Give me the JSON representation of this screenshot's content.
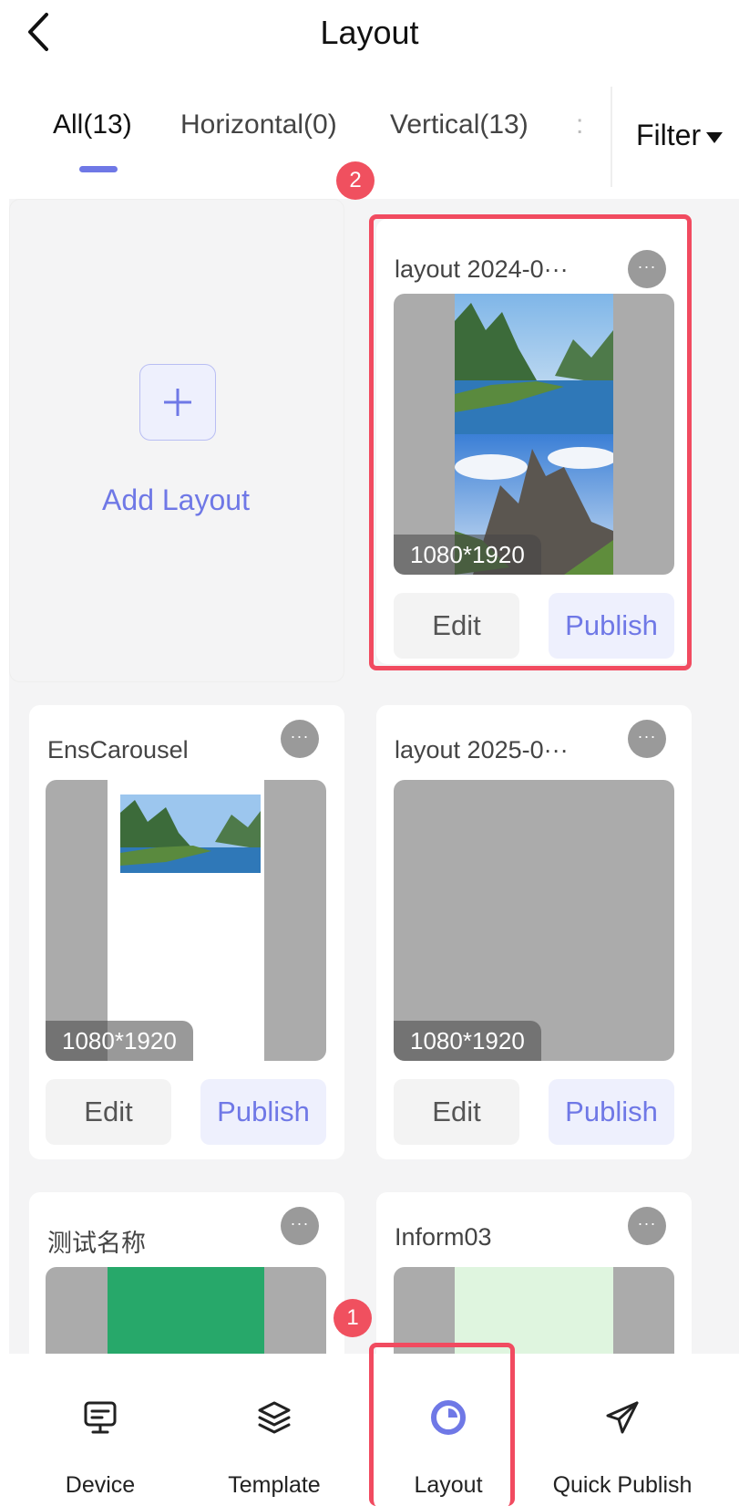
{
  "header": {
    "title": "Layout"
  },
  "tabs": [
    {
      "label": "All(13)"
    },
    {
      "label": "Horizontal(0)"
    },
    {
      "label": "Vertical(13)"
    },
    {
      "label": ":"
    }
  ],
  "filter": {
    "label": "Filter"
  },
  "add_card": {
    "label": "Add Layout"
  },
  "cards": [
    {
      "title": "layout 2024-0···",
      "resolution": "1080*1920",
      "edit": "Edit",
      "publish": "Publish"
    },
    {
      "title": "EnsCarousel",
      "resolution": "1080*1920",
      "edit": "Edit",
      "publish": "Publish"
    },
    {
      "title": "layout 2025-0···",
      "resolution": "1080*1920",
      "edit": "Edit",
      "publish": "Publish"
    },
    {
      "title": "测试名称"
    },
    {
      "title": "Inform03"
    }
  ],
  "more_icon": "···",
  "badges": {
    "first": "1",
    "second": "2"
  },
  "bottom_nav": [
    {
      "label": "Device",
      "icon": "monitor-icon"
    },
    {
      "label": "Template",
      "icon": "layers-icon"
    },
    {
      "label": "Layout",
      "icon": "layout-icon"
    },
    {
      "label": "Quick Publish",
      "icon": "send-icon"
    }
  ],
  "colors": {
    "accent": "#6f78e6",
    "highlight": "#f14b60",
    "background": "#f4f4f5"
  }
}
